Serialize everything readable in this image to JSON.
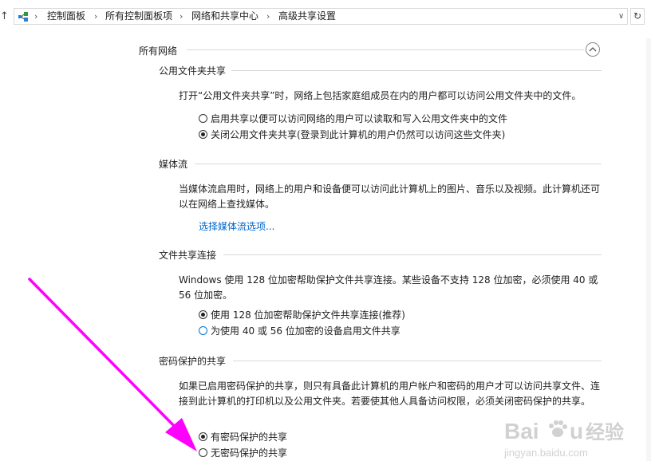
{
  "address_bar": {
    "breadcrumbs": [
      "控制面板",
      "所有控制面板项",
      "网络和共享中心",
      "高级共享设置"
    ],
    "up_icon": "up-arrow-icon",
    "network_icon": "network-icon",
    "refresh_icon": "refresh-icon"
  },
  "group": {
    "title": "所有网络",
    "collapse_icon": "chevron-up-icon"
  },
  "public_folder": {
    "title": "公用文件夹共享",
    "description": "打开“公用文件夹共享”时，网络上包括家庭组成员在内的用户都可以访问公用文件夹中的文件。",
    "options": [
      {
        "label": "启用共享以便可以访问网络的用户可以读取和写入公用文件夹中的文件",
        "selected": false
      },
      {
        "label": "关闭公用文件夹共享(登录到此计算机的用户仍然可以访问这些文件夹)",
        "selected": true
      }
    ]
  },
  "media_streaming": {
    "title": "媒体流",
    "description": "当媒体流启用时，网络上的用户和设备便可以访问此计算机上的图片、音乐以及视频。此计算机还可以在网络上查找媒体。",
    "link": "选择媒体流选项..."
  },
  "file_sharing": {
    "title": "文件共享连接",
    "description": "Windows 使用 128 位加密帮助保护文件共享连接。某些设备不支持 128 位加密，必须使用 40 或 56 位加密。",
    "options": [
      {
        "label": "使用 128 位加密帮助保护文件共享连接(推荐)",
        "selected": true
      },
      {
        "label": "为使用 40 或 56 位加密的设备启用文件共享",
        "selected": false
      }
    ]
  },
  "password_sharing": {
    "title": "密码保护的共享",
    "description": "如果已启用密码保护的共享，则只有具备此计算机的用户帐户和密码的用户才可以访问共享文件、连接到此计算机的打印机以及公用文件夹。若要使其他人具备访问权限，必须关闭密码保护的共享。",
    "options": [
      {
        "label": "有密码保护的共享",
        "selected": true
      },
      {
        "label": "无密码保护的共享",
        "selected": false
      }
    ]
  },
  "annotation": {
    "arrow_color": "#ff00ff"
  },
  "watermark": {
    "text": "Baidu经验",
    "subtext": "jingyan.baidu.com"
  },
  "colors": {
    "link": "#0066cc",
    "divider": "#d9d9d9",
    "radio_focus": "#0078d7"
  }
}
